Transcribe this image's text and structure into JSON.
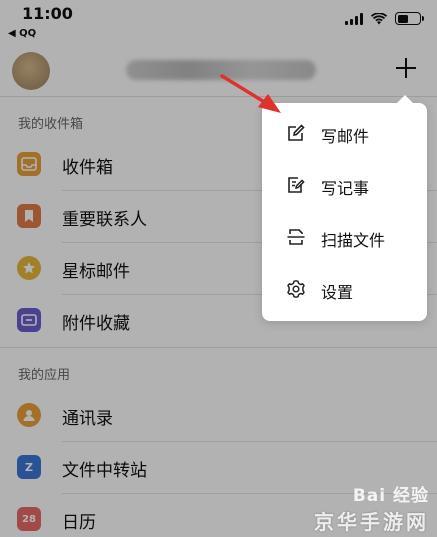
{
  "status_bar": {
    "time": "11:00",
    "back_app": "◀ QQ"
  },
  "sections": [
    {
      "title": "我的收件箱",
      "items": [
        {
          "label": "收件箱",
          "color": "#e8a13c",
          "icon": "inbox-icon"
        },
        {
          "label": "重要联系人",
          "color": "#e07b4a",
          "icon": "bookmark-icon"
        },
        {
          "label": "星标邮件",
          "color": "#e8b63c",
          "icon": "star-icon"
        },
        {
          "label": "附件收藏",
          "color": "#6a5fd0",
          "icon": "attachment-icon"
        }
      ]
    },
    {
      "title": "我的应用",
      "items": [
        {
          "label": "通讯录",
          "color": "#e8a13c",
          "icon": "contacts-icon"
        },
        {
          "label": "文件中转站",
          "color": "#3b77d6",
          "icon": "file-transfer-icon",
          "glyph": "Z"
        },
        {
          "label": "日历",
          "color": "#e96a6a",
          "icon": "calendar-icon",
          "glyph": "28"
        }
      ]
    }
  ],
  "menu": {
    "items": [
      {
        "label": "写邮件",
        "icon": "compose-icon"
      },
      {
        "label": "写记事",
        "icon": "note-icon"
      },
      {
        "label": "扫描文件",
        "icon": "scan-icon"
      },
      {
        "label": "设置",
        "icon": "gear-icon"
      }
    ]
  },
  "watermark": {
    "line1": "Bai 经验",
    "line2": "京华手游网"
  },
  "colors": {
    "accent_arrow": "#e0312d",
    "overlay": "rgba(0,0,0,0.30)"
  }
}
